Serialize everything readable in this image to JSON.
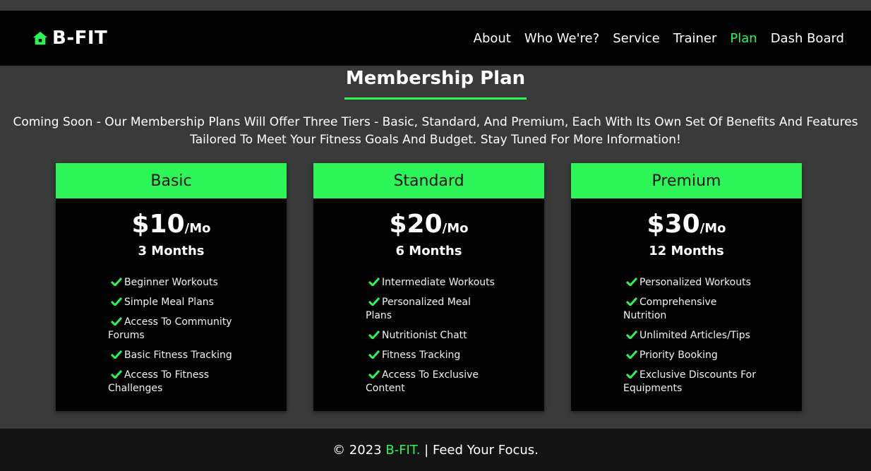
{
  "brand": {
    "name": "B-FIT"
  },
  "nav": {
    "items": [
      {
        "label": "About"
      },
      {
        "label": "Who We're?"
      },
      {
        "label": "Service"
      },
      {
        "label": "Trainer"
      },
      {
        "label": "Plan"
      },
      {
        "label": "Dash Board"
      }
    ],
    "active": "Plan"
  },
  "section": {
    "title": "Membership Plan",
    "intro_line1": "Coming Soon - Our Membership Plans Will Offer Three Tiers - Basic, Standard, And Premium, Each With Its Own Set Of Benefits And Features",
    "intro_line2": "Tailored To Meet Your Fitness Goals And Budget. Stay Tuned For More Information!"
  },
  "plans": [
    {
      "name": "Basic",
      "price": "$10",
      "per": "/Mo",
      "duration": "3 Months",
      "features": [
        "Beginner Workouts",
        "Simple Meal Plans",
        "Access To Community Forums",
        "Basic Fitness Tracking",
        "Access To Fitness Challenges"
      ]
    },
    {
      "name": "Standard",
      "price": "$20",
      "per": "/Mo",
      "duration": "6 Months",
      "features": [
        "Intermediate Workouts",
        "Personalized Meal Plans",
        "Nutritionist Chatt",
        "Fitness Tracking",
        "Access To Exclusive Content"
      ]
    },
    {
      "name": "Premium",
      "price": "$30",
      "per": "/Mo",
      "duration": "12 Months",
      "features": [
        "Personalized Workouts",
        "Comprehensive Nutrition",
        "Unlimited Articles/Tips",
        "Priority Booking",
        "Exclusive Discounts For Equipments"
      ]
    }
  ],
  "footer": {
    "copyright": "© 2023",
    "brand": "B-FIT.",
    "tagline": "| Feed Your Focus."
  },
  "colors": {
    "accent": "#2cf557",
    "navbar": "#030303",
    "page_bg": "#3a3a3a",
    "card_bg": "#020202",
    "footer_bg": "#141414"
  },
  "icons": {
    "brand": "home-icon",
    "feature": "check-icon"
  }
}
